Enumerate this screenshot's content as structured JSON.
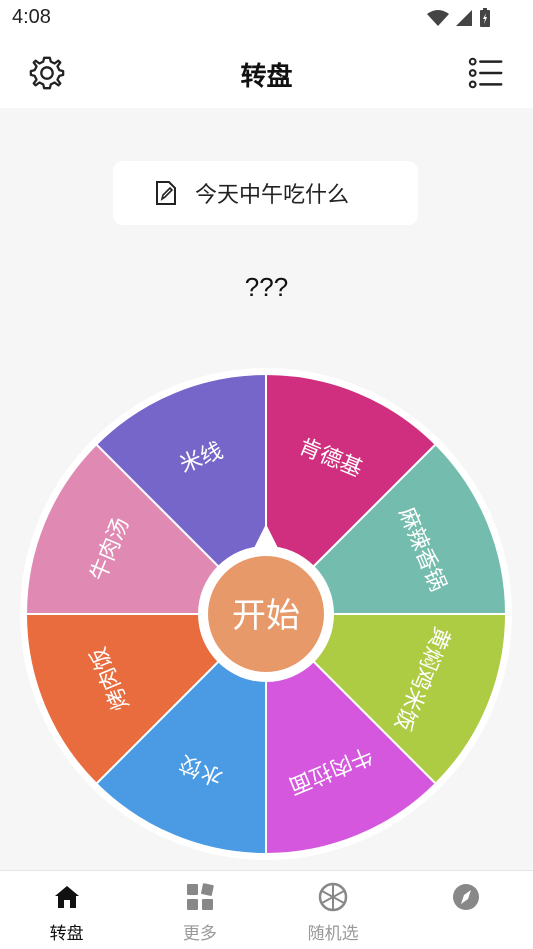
{
  "status": {
    "time": "4:08"
  },
  "header": {
    "title": "转盘"
  },
  "question": {
    "text": "今天中午吃什么"
  },
  "result": {
    "text": "???"
  },
  "wheel": {
    "center_label": "开始",
    "segments": [
      {
        "label": "肯德基",
        "color": "#cf2f7e"
      },
      {
        "label": "麻辣香锅",
        "color": "#74bdae"
      },
      {
        "label": "黄焖鸡米饭",
        "color": "#aecb44"
      },
      {
        "label": "牛肉拉面",
        "color": "#d457dd"
      },
      {
        "label": "水饺",
        "color": "#4a9be3"
      },
      {
        "label": "烤肉饭",
        "color": "#e96c3e"
      },
      {
        "label": "牛肉汤",
        "color": "#e08ab3"
      },
      {
        "label": "米线",
        "color": "#7766c9"
      }
    ],
    "center_color": "#e8996a"
  },
  "tabs": [
    {
      "label": "转盘",
      "icon": "home-icon",
      "active": true
    },
    {
      "label": "更多",
      "icon": "grid-icon",
      "active": false
    },
    {
      "label": "随机选",
      "icon": "aperture-icon",
      "active": false
    },
    {
      "label": "",
      "icon": "compass-icon",
      "active": false
    }
  ]
}
